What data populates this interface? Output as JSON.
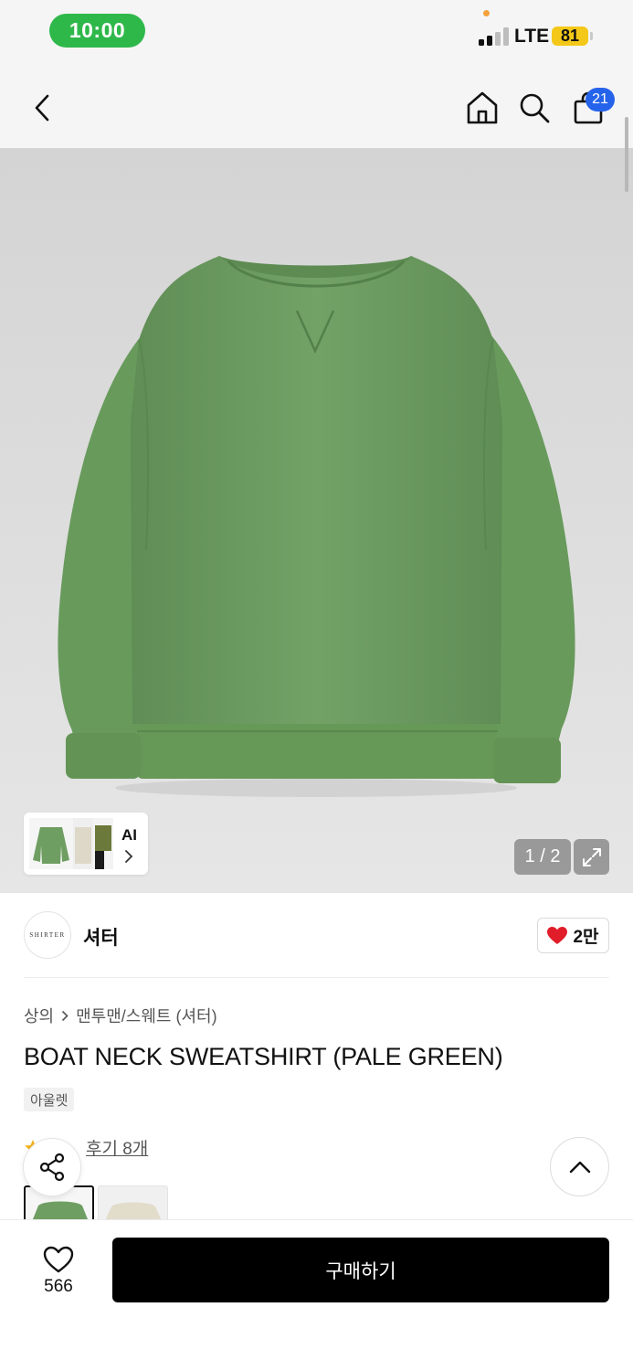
{
  "status_bar": {
    "time": "10:00",
    "network": "LTE",
    "battery": "81"
  },
  "nav": {
    "cart_count": "21"
  },
  "gallery": {
    "ai_label": "AI",
    "page_indicator": "1 / 2"
  },
  "brand": {
    "logo_text": "SHIRTER",
    "name": "셔터",
    "likes": "2만"
  },
  "product": {
    "breadcrumb": [
      "상의",
      "맨투맨/스웨트 (셔터)"
    ],
    "title": "BOAT NECK SWEATSHIRT (PALE GREEN)",
    "tag": "아울렛",
    "review_label": "후기 8개"
  },
  "footer": {
    "wish_count": "566",
    "buy_label": "구매하기"
  },
  "colors": {
    "sweater_green": "#6f9e63",
    "cart_badge": "#2563eb",
    "time_pill": "#2fb84a",
    "battery": "#f4c818",
    "heart": "#e11d2a"
  }
}
